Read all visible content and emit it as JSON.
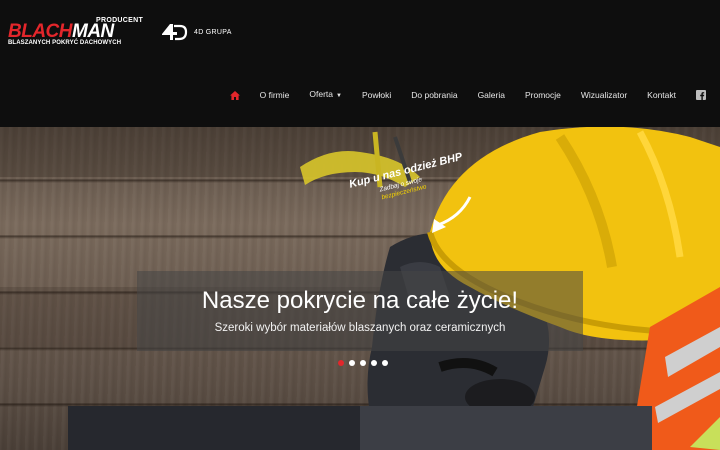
{
  "brand": {
    "name_part1": "BLACH",
    "name_part2": "MAN",
    "producent": "PRODUCENT",
    "tagline": "BLASZANYCH POKRYĆ DACHOWYCH",
    "partner": "4D GRUPA",
    "accent_color": "#e3262b"
  },
  "nav": {
    "home_icon": "home-icon",
    "items": [
      {
        "label": "O firmie"
      },
      {
        "label": "Oferta"
      },
      {
        "label": "Powłoki"
      },
      {
        "label": "Do pobrania"
      },
      {
        "label": "Galeria"
      },
      {
        "label": "Promocje"
      },
      {
        "label": "Wizualizator"
      },
      {
        "label": "Kontakt"
      }
    ],
    "social_icon": "facebook-icon"
  },
  "hero": {
    "promo_main": "Kup u nas odzież BHP",
    "promo_small_1": "Zadbaj o swoje",
    "promo_small_2": "bezpieczeństwo",
    "title": "Nasze pokrycie na całe życie!",
    "subtitle": "Szeroki wybór materiałów blaszanych oraz ceramicznych",
    "slide_count": 5,
    "active_slide": 1
  }
}
